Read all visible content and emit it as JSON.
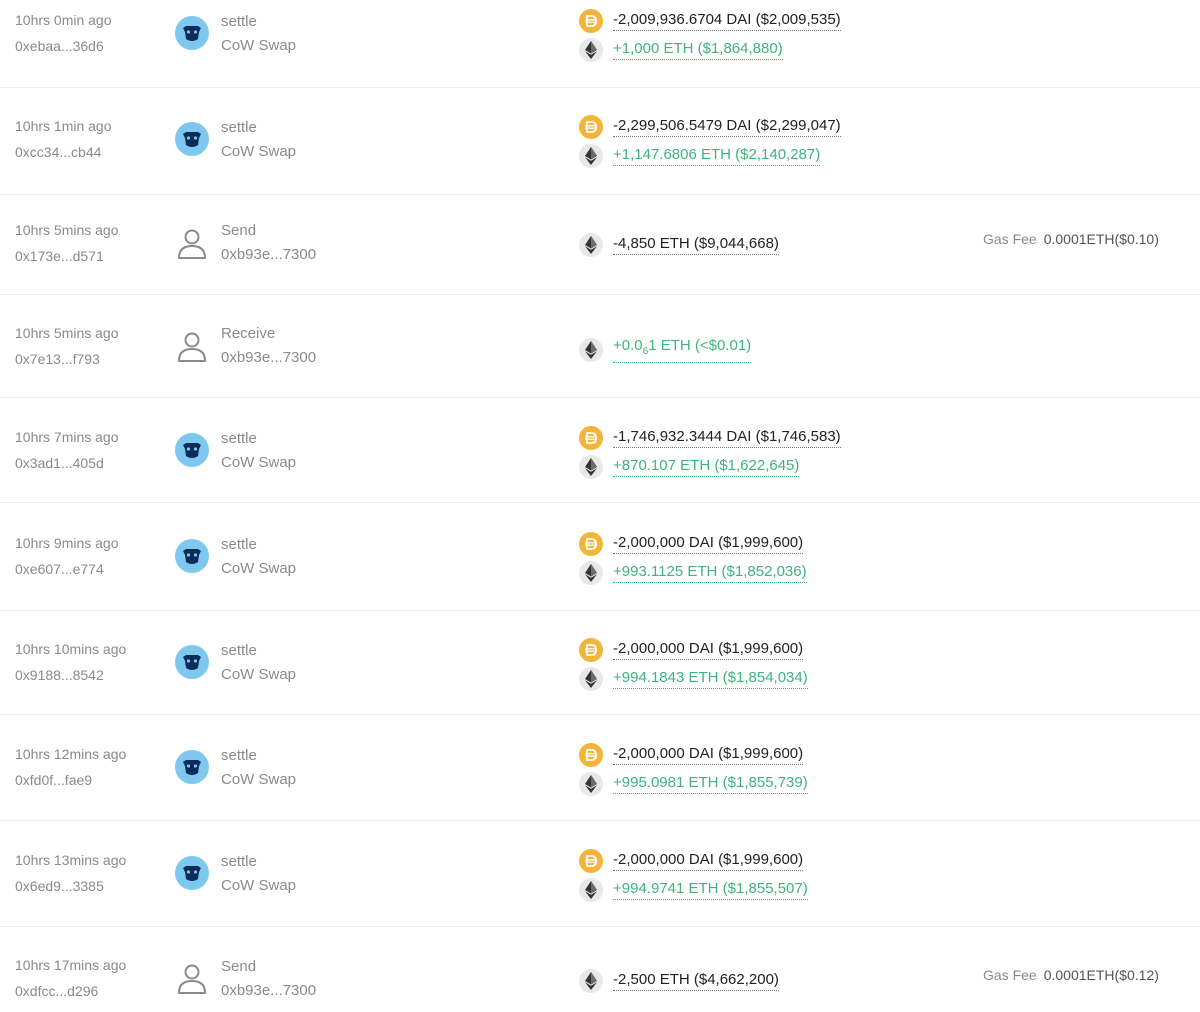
{
  "colors": {
    "positive": "#3fb37e",
    "negative": "#222222",
    "dai": "#f2b53a",
    "eth_bg": "#e8e8e8",
    "cow": "#7ec8f0"
  },
  "gas_label": "Gas Fee",
  "transactions": [
    {
      "time": "10hrs 0min ago",
      "hash": "0xebaa...36d6",
      "action": "settle",
      "counterparty": "CoW Swap",
      "icon": "cow-icon",
      "transfers": [
        {
          "token": "dai",
          "amount": "-2,009,936.6704 DAI ($2,009,535)",
          "direction": "out"
        },
        {
          "token": "eth",
          "amount": "+1,000 ETH ($1,864,880)",
          "direction": "in"
        }
      ],
      "gas_fee": ""
    },
    {
      "time": "10hrs 1min ago",
      "hash": "0xcc34...cb44",
      "action": "settle",
      "counterparty": "CoW Swap",
      "icon": "cow-icon",
      "transfers": [
        {
          "token": "dai",
          "amount": "-2,299,506.5479 DAI ($2,299,047)",
          "direction": "out"
        },
        {
          "token": "eth",
          "amount": "+1,147.6806 ETH ($2,140,287)",
          "direction": "in"
        }
      ],
      "gas_fee": ""
    },
    {
      "time": "10hrs 5mins ago",
      "hash": "0x173e...d571",
      "action": "Send",
      "counterparty": "0xb93e...7300",
      "icon": "user-icon",
      "transfers": [
        {
          "token": "eth",
          "amount": "-4,850 ETH ($9,044,668)",
          "direction": "out"
        }
      ],
      "gas_fee": "0.0001ETH($0.10)"
    },
    {
      "time": "10hrs 5mins ago",
      "hash": "0x7e13...f793",
      "action": "Receive",
      "counterparty": "0xb93e...7300",
      "icon": "user-icon",
      "transfers": [
        {
          "token": "eth",
          "amount_prefix": "+0.0",
          "amount_sub": "6",
          "amount_suffix": "1 ETH (<$0.01)",
          "direction": "in"
        }
      ],
      "gas_fee": ""
    },
    {
      "time": "10hrs 7mins ago",
      "hash": "0x3ad1...405d",
      "action": "settle",
      "counterparty": "CoW Swap",
      "icon": "cow-icon",
      "transfers": [
        {
          "token": "dai",
          "amount": "-1,746,932.3444 DAI ($1,746,583)",
          "direction": "out"
        },
        {
          "token": "eth",
          "amount": "+870.107 ETH ($1,622,645)",
          "direction": "in"
        }
      ],
      "gas_fee": ""
    },
    {
      "time": "10hrs 9mins ago",
      "hash": "0xe607...e774",
      "action": "settle",
      "counterparty": "CoW Swap",
      "icon": "cow-icon",
      "transfers": [
        {
          "token": "dai",
          "amount": "-2,000,000 DAI ($1,999,600)",
          "direction": "out"
        },
        {
          "token": "eth",
          "amount": "+993.1125 ETH ($1,852,036)",
          "direction": "in"
        }
      ],
      "gas_fee": ""
    },
    {
      "time": "10hrs 10mins ago",
      "hash": "0x9188...8542",
      "action": "settle",
      "counterparty": "CoW Swap",
      "icon": "cow-icon",
      "transfers": [
        {
          "token": "dai",
          "amount": "-2,000,000 DAI ($1,999,600)",
          "direction": "out"
        },
        {
          "token": "eth",
          "amount": "+994.1843 ETH ($1,854,034)",
          "direction": "in"
        }
      ],
      "gas_fee": ""
    },
    {
      "time": "10hrs 12mins ago",
      "hash": "0xfd0f...fae9",
      "action": "settle",
      "counterparty": "CoW Swap",
      "icon": "cow-icon",
      "transfers": [
        {
          "token": "dai",
          "amount": "-2,000,000 DAI ($1,999,600)",
          "direction": "out"
        },
        {
          "token": "eth",
          "amount": "+995.0981 ETH ($1,855,739)",
          "direction": "in"
        }
      ],
      "gas_fee": ""
    },
    {
      "time": "10hrs 13mins ago",
      "hash": "0x6ed9...3385",
      "action": "settle",
      "counterparty": "CoW Swap",
      "icon": "cow-icon",
      "transfers": [
        {
          "token": "dai",
          "amount": "-2,000,000 DAI ($1,999,600)",
          "direction": "out"
        },
        {
          "token": "eth",
          "amount": "+994.9741 ETH ($1,855,507)",
          "direction": "in"
        }
      ],
      "gas_fee": ""
    },
    {
      "time": "10hrs 17mins ago",
      "hash": "0xdfcc...d296",
      "action": "Send",
      "counterparty": "0xb93e...7300",
      "icon": "user-icon",
      "transfers": [
        {
          "token": "eth",
          "amount": "-2,500 ETH ($4,662,200)",
          "direction": "out"
        }
      ],
      "gas_fee": "0.0001ETH($0.12)"
    }
  ]
}
